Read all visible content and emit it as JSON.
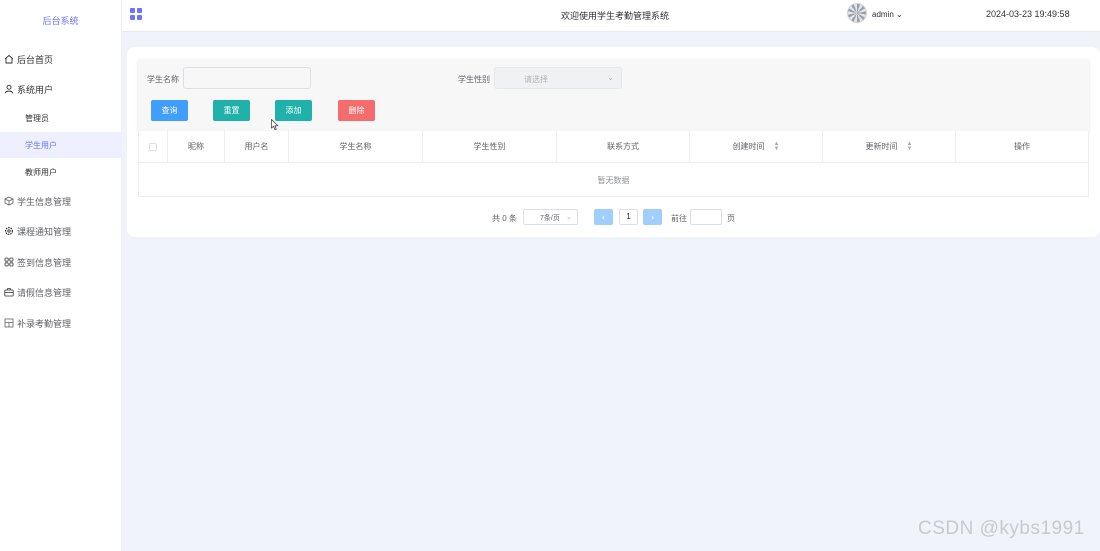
{
  "app": {
    "title": "后台系统"
  },
  "sidebar": {
    "items": [
      {
        "label": "后台首页",
        "icon": "home-icon"
      },
      {
        "label": "系统用户",
        "icon": "user-icon"
      },
      {
        "label": "管理员"
      },
      {
        "label": "学生用户"
      },
      {
        "label": "教师用户"
      },
      {
        "label": "学生信息管理",
        "icon": "box-icon"
      },
      {
        "label": "课程通知管理",
        "icon": "gear-icon"
      },
      {
        "label": "签到信息管理",
        "icon": "grid-icon"
      },
      {
        "label": "请假信息管理",
        "icon": "briefcase-icon"
      },
      {
        "label": "补录考勤管理",
        "icon": "layout-icon"
      }
    ]
  },
  "header": {
    "title": "欢迎使用学生考勤管理系统",
    "user": "admin",
    "datetime": "2024-03-23 19:49:58"
  },
  "search": {
    "name_label": "学生名称",
    "name_value": "",
    "gender_label": "学生性别",
    "gender_placeholder": "请选择"
  },
  "buttons": {
    "query": "查询",
    "reset": "重置",
    "add": "添加",
    "delete": "删除"
  },
  "colors": {
    "accent": "#6a72ff",
    "query": "#409eff",
    "reset": "#20b2aa",
    "add": "#20b2aa",
    "delete": "#f56c6c"
  },
  "table": {
    "columns": [
      "昵称",
      "用户名",
      "学生名称",
      "学生性别",
      "联系方式",
      "创建时间",
      "更新时间",
      "操作"
    ],
    "rows": [],
    "empty_text": "暂无数据"
  },
  "pagination": {
    "total_text": "共 0 条",
    "page_size": "7条/页",
    "current_page": "1",
    "goto_label": "前往",
    "page_suffix": "页"
  },
  "watermark": "CSDN @kybs1991"
}
